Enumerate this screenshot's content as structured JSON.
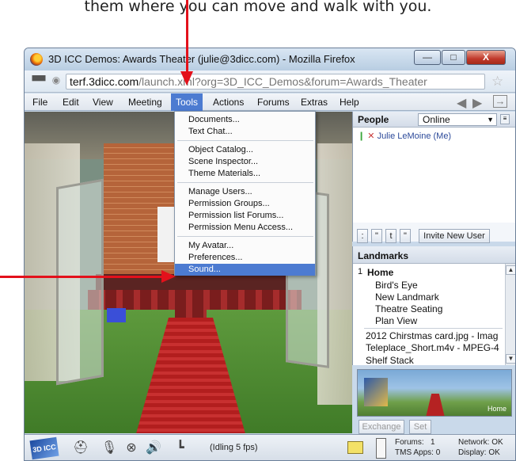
{
  "caption": "them where you can move and walk with you.",
  "window": {
    "title": "3D ICC Demos: Awards Theater (julie@3dicc.com) - Mozilla Firefox",
    "min_label": "—",
    "max_label": "□",
    "close_label": "X"
  },
  "address": {
    "host": "terf.3dicc.com",
    "path": "/launch.xml?org=3D_ICC_Demos&forum=Awards_Theater"
  },
  "menu": {
    "items": [
      "File",
      "Edit",
      "View",
      "Meeting",
      "Tools",
      "Actions",
      "Forums",
      "Extras",
      "Help"
    ],
    "active": "Tools"
  },
  "tools_menu": {
    "groups": [
      [
        "Documents...",
        "Text Chat..."
      ],
      [
        "Object Catalog...",
        "Scene Inspector...",
        "Theme Materials..."
      ],
      [
        "Manage Users...",
        "Permission Groups...",
        "Permission list Forums...",
        "Permission Menu Access..."
      ],
      [
        "My Avatar...",
        "Preferences...",
        "Sound..."
      ]
    ],
    "selected": "Sound..."
  },
  "people": {
    "title": "People",
    "filter_value": "Online",
    "users": [
      "Julie LeMoine  (Me)"
    ],
    "toolbar": [
      ":",
      "\"",
      "t",
      "\"",
      "Invite New User"
    ]
  },
  "landmarks": {
    "title": "Landmarks",
    "home_index": "1",
    "home": "Home",
    "items": [
      "Bird's Eye",
      "New Landmark",
      "Theatre Seating",
      "Plan View"
    ],
    "files": [
      "2012 Chirstmas card.jpg - Imag",
      "Teleplace_Short.m4v - MPEG-4"
    ],
    "partial": "Shelf Stack",
    "minimap_label": "Home",
    "exchange_label": "Exchange",
    "set_label": "Set"
  },
  "status": {
    "logo": "3D ICC",
    "idle": "(Idling 5 fps)",
    "forums_label": "Forums:",
    "forums_value": "1",
    "tms_label": "TMS Apps:",
    "tms_value": "0",
    "network_label": "Network: OK",
    "display_label": "Display: OK"
  },
  "colors": {
    "accent": "#4c7bd1",
    "annotation_arrow": "#e3111b"
  }
}
